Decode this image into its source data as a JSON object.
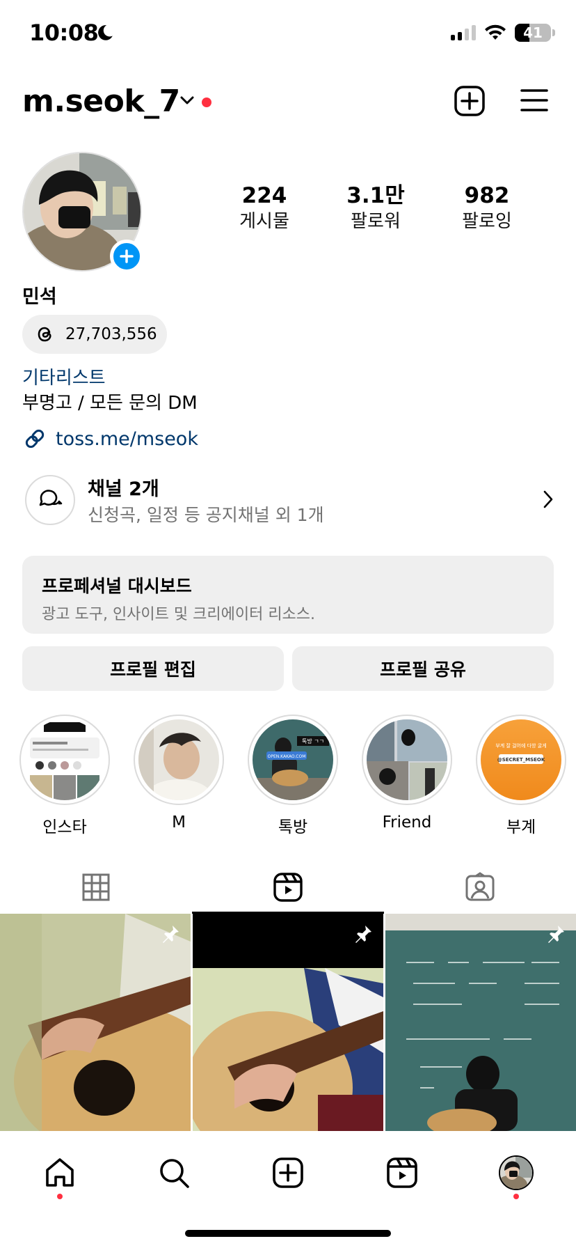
{
  "status_bar": {
    "time": "10:08",
    "battery": "41",
    "battery_level": 0.41
  },
  "header": {
    "username": "m.seok_7"
  },
  "stats": [
    {
      "value": "224",
      "label": "게시물"
    },
    {
      "value": "3.1만",
      "label": "팔로워"
    },
    {
      "value": "982",
      "label": "팔로잉"
    }
  ],
  "profile": {
    "name": "민석",
    "threads_count": "27,703,556",
    "category": "기타리스트",
    "bio": "부명고 / 모든 문의 DM",
    "link": "toss.me/mseok"
  },
  "channel": {
    "title": "채널 2개",
    "subtitle": "신청곡, 일정 등 공지채널 외 1개"
  },
  "dashboard": {
    "title": "프로페셔널 대시보드",
    "subtitle": "광고 도구, 인사이트 및 크리에이터 리소스."
  },
  "buttons": {
    "edit": "프로필 편집",
    "share": "프로필 공유"
  },
  "highlights": [
    {
      "label": "인스타"
    },
    {
      "label": "M"
    },
    {
      "label": "톡방"
    },
    {
      "label": "Friend"
    },
    {
      "label": "부계"
    }
  ],
  "highlight_texts": {
    "talk_badge": "톡방 ㄱㄱ",
    "talk_url": "OPEN.KAKAO.COM",
    "sub_line": "부계 잘 걸어에 다방 굴게",
    "sub_tag": "@SECRET_MSEOK"
  },
  "colors": {
    "accent": "#0095f6",
    "link": "#00376b",
    "notification": "#ff3040",
    "pill_bg": "#efefef"
  },
  "icons": [
    "moon-icon",
    "chevron-down-icon",
    "new-post-icon",
    "menu-icon",
    "threads-icon",
    "link-icon",
    "channel-icon",
    "chevron-right-icon",
    "grid-icon",
    "reels-icon",
    "tagged-icon",
    "pin-icon",
    "home-icon",
    "search-icon",
    "create-icon"
  ]
}
